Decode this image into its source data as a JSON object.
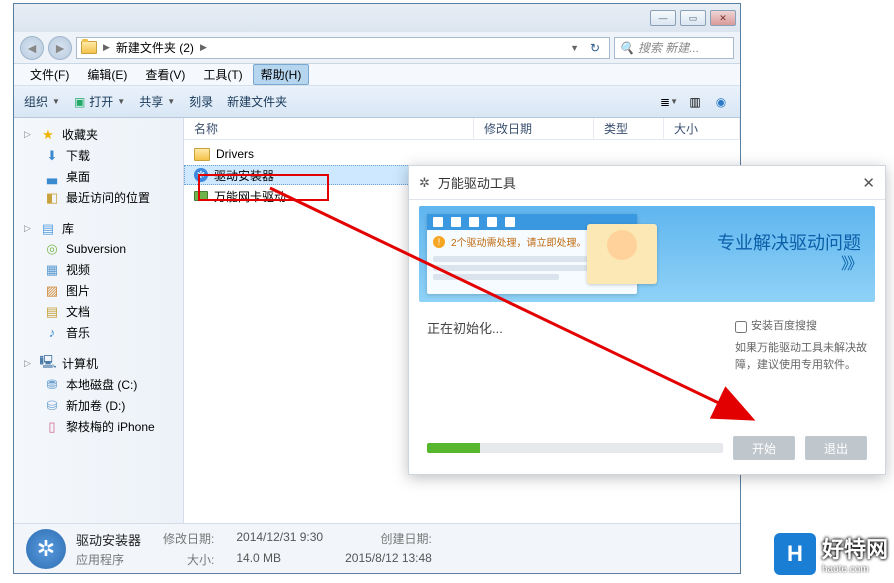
{
  "window": {
    "breadcrumb_root": "新建文件夹 (2)",
    "breadcrumb_sep": "▶",
    "search_placeholder": "搜索 新建..."
  },
  "menu": {
    "file": "文件(F)",
    "edit": "编辑(E)",
    "view": "查看(V)",
    "tools": "工具(T)",
    "help": "帮助(H)"
  },
  "toolbar": {
    "organize": "组织",
    "open": "打开",
    "share": "共享",
    "burn": "刻录",
    "newfolder": "新建文件夹"
  },
  "sidebar": {
    "favorites": "收藏夹",
    "fav_items": {
      "downloads": "下载",
      "desktop": "桌面",
      "recent": "最近访问的位置"
    },
    "libraries": "库",
    "lib_items": {
      "subversion": "Subversion",
      "videos": "视频",
      "pictures": "图片",
      "documents": "文档",
      "music": "音乐"
    },
    "computer": "计算机",
    "comp_items": {
      "c": "本地磁盘 (C:)",
      "d": "新加卷 (D:)",
      "iphone": "黎枝梅的 iPhone"
    }
  },
  "columns": {
    "name": "名称",
    "date": "修改日期",
    "type": "类型",
    "size": "大小"
  },
  "files": {
    "f0": "Drivers",
    "f1": "驱动安装器",
    "f2": "万能网卡驱动"
  },
  "details": {
    "title": "驱动安装器",
    "apptype": "应用程序",
    "mod_lbl": "修改日期:",
    "mod_val": "2014/12/31 9:30",
    "size_lbl": "大小:",
    "size_val": "14.0 MB",
    "create_lbl": "创建日期:",
    "create_val": "2015/8/12 13:48"
  },
  "dialog": {
    "title": "万能驱动工具",
    "banner_text": "专业解决驱动问题",
    "banner_arrows": "》》",
    "banner_inner": "2个驱动需处理，请立即处理。",
    "status": "正在初始化...",
    "check_label": "安装百度搜搜",
    "hint": "如果万能驱动工具未解决故障，建议使用专用软件。",
    "btn_start": "开始",
    "btn_exit": "退出"
  },
  "logo": {
    "letter": "H",
    "text": "好特网",
    "sub": "haote.com"
  }
}
